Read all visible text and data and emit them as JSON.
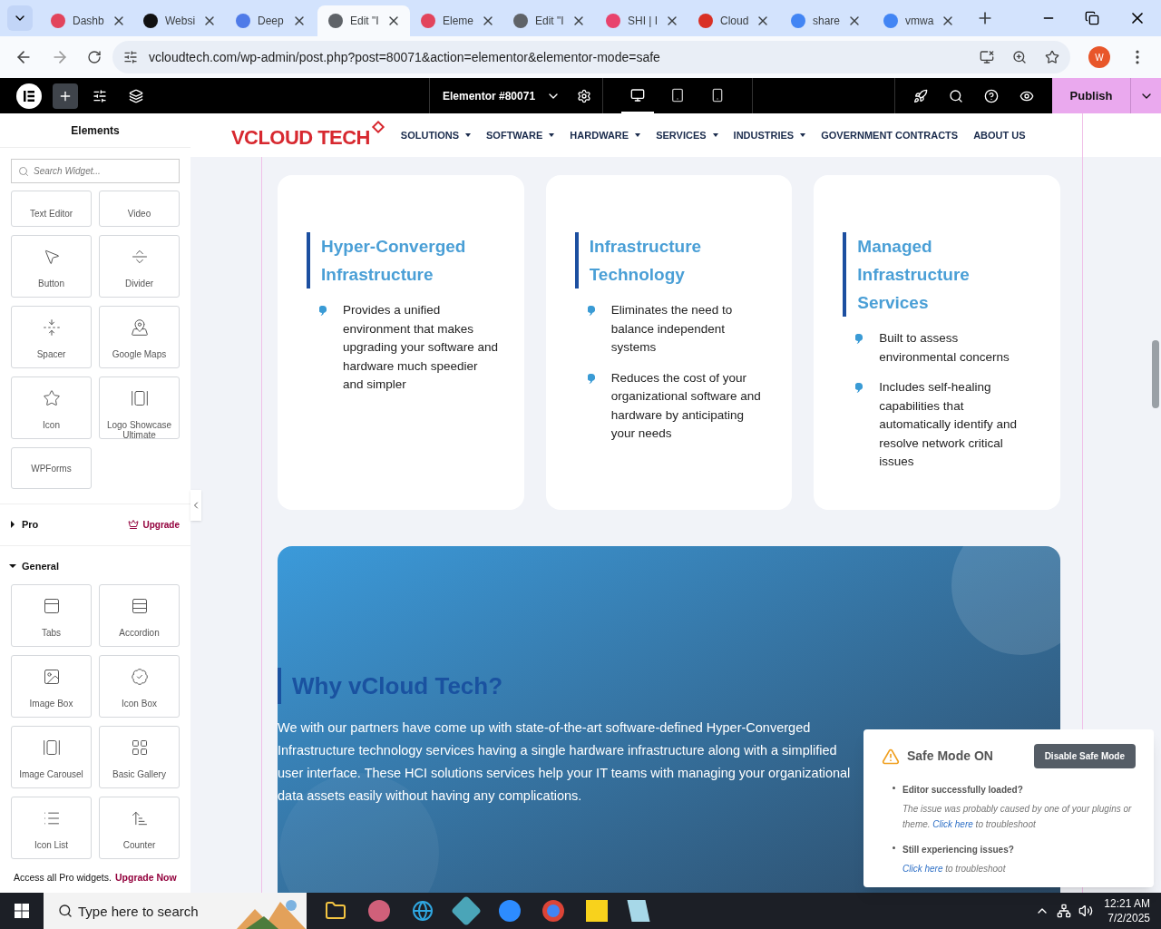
{
  "browser": {
    "tabs": [
      {
        "label": "Dashb",
        "selected": false
      },
      {
        "label": "Websi",
        "selected": false
      },
      {
        "label": "Deep",
        "selected": false
      },
      {
        "label": "Edit \"I",
        "selected": true
      },
      {
        "label": "Eleme",
        "selected": false
      },
      {
        "label": "Edit \"I",
        "selected": false
      },
      {
        "label": "SHI | I",
        "selected": false
      },
      {
        "label": "Cloud",
        "selected": false
      },
      {
        "label": "share",
        "selected": false
      },
      {
        "label": "vmwa",
        "selected": false
      }
    ],
    "address": "vcloudtech.com/wp-admin/post.php?post=80071&action=elementor&elementor-mode=safe",
    "profile": "W"
  },
  "editor_bar": {
    "document_title": "Elementor #80071",
    "devices": [
      {
        "kind": "desktop",
        "selected": true
      },
      {
        "kind": "tablet",
        "selected": false
      },
      {
        "kind": "mobile",
        "selected": false
      }
    ],
    "publish": "Publish"
  },
  "panel": {
    "title": "Elements",
    "search": {
      "placeholder": "Search Widget..."
    },
    "widgets": [
      "Text Editor",
      "Video",
      "Button",
      "Divider",
      "Spacer",
      "Google Maps",
      "Icon",
      "Logo Showcase Ultimate",
      "WPForms"
    ],
    "sections": [
      {
        "label": "Pro",
        "expanded": false,
        "action": "Upgrade"
      },
      {
        "label": "General",
        "expanded": true,
        "widgets": [
          "Tabs",
          "Accordion",
          "Image Box",
          "Icon Box",
          "Image Carousel",
          "Basic Gallery",
          "Icon List",
          "Counter"
        ]
      }
    ],
    "promo": {
      "text": "Access all Pro widgets.",
      "link": "Upgrade Now"
    }
  },
  "site": {
    "logo": "VCLOUD TECH",
    "nav": [
      {
        "label": "SOLUTIONS",
        "dropdown": true
      },
      {
        "label": "SOFTWARE",
        "dropdown": true
      },
      {
        "label": "HARDWARE",
        "dropdown": true
      },
      {
        "label": "SERVICES",
        "dropdown": true
      },
      {
        "label": "INDUSTRIES",
        "dropdown": true
      },
      {
        "label": "GOVERNMENT CONTRACTS",
        "dropdown": false
      },
      {
        "label": "ABOUT US",
        "dropdown": false
      }
    ],
    "cards": [
      {
        "title": "Hyper-Converged Infrastructure",
        "bullets": [
          "Provides a unified environment that makes upgrading your software and hardware much speedier and simpler"
        ]
      },
      {
        "title": "Infrastructure Technology",
        "bullets": [
          "Eliminates the need to balance independent systems",
          "Reduces the cost of your organizational software and hardware by anticipating your needs"
        ]
      },
      {
        "title": "Managed Infrastructure Services",
        "bullets": [
          "Built to assess environmental concerns",
          "Includes self-healing capabilities that automatically identify and resolve network critical issues"
        ]
      }
    ],
    "why": {
      "heading": "Why vCloud Tech?",
      "text": "We with our partners have come up with state-of-the-art software-defined Hyper-Converged Infrastructure technology services having a single hardware infrastructure along with a simplified user interface. These HCI solutions services help your IT teams with managing your organizational data assets easily without having any complications."
    }
  },
  "safe_mode": {
    "title": "Safe Mode ON",
    "button": "Disable Safe Mode",
    "items": [
      {
        "title": "Editor successfully loaded?",
        "text": "The issue was probably caused by one of your plugins or theme.",
        "link": "Click here",
        "suffix": "to troubleshoot"
      },
      {
        "title": "Still experiencing issues?",
        "link": "Click here",
        "suffix": "to troubleshoot"
      }
    ]
  },
  "taskbar": {
    "search_placeholder": "Type here to search",
    "time": "12:21 AM",
    "date": "7/2/2025"
  }
}
